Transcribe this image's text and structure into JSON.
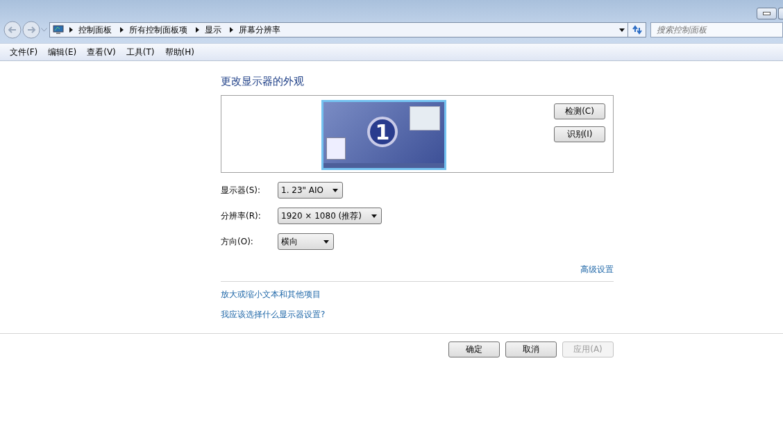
{
  "address_bar": {
    "breadcrumbs": [
      "控制面板",
      "所有控制面板项",
      "显示",
      "屏幕分辨率"
    ]
  },
  "search": {
    "placeholder": "搜索控制面板"
  },
  "menu": [
    "文件(F)",
    "编辑(E)",
    "查看(V)",
    "工具(T)",
    "帮助(H)"
  ],
  "heading": "更改显示器的外观",
  "preview": {
    "monitor_number": "1",
    "buttons": [
      {
        "label": "检测(C)"
      },
      {
        "label": "识别(I)"
      }
    ]
  },
  "settings": [
    {
      "label": "显示器(S):",
      "value": "1. 23\" AIO"
    },
    {
      "label": "分辨率(R):",
      "value": "1920 × 1080 (推荐)"
    },
    {
      "label": "方向(O):",
      "value": "横向"
    }
  ],
  "advanced_link": "高级设置",
  "links": [
    "放大或缩小文本和其他项目",
    "我应该选择什么显示器设置?"
  ],
  "buttons": [
    {
      "label": "确定",
      "disabled": false
    },
    {
      "label": "取消",
      "disabled": false
    },
    {
      "label": "应用(A)",
      "disabled": true
    }
  ]
}
